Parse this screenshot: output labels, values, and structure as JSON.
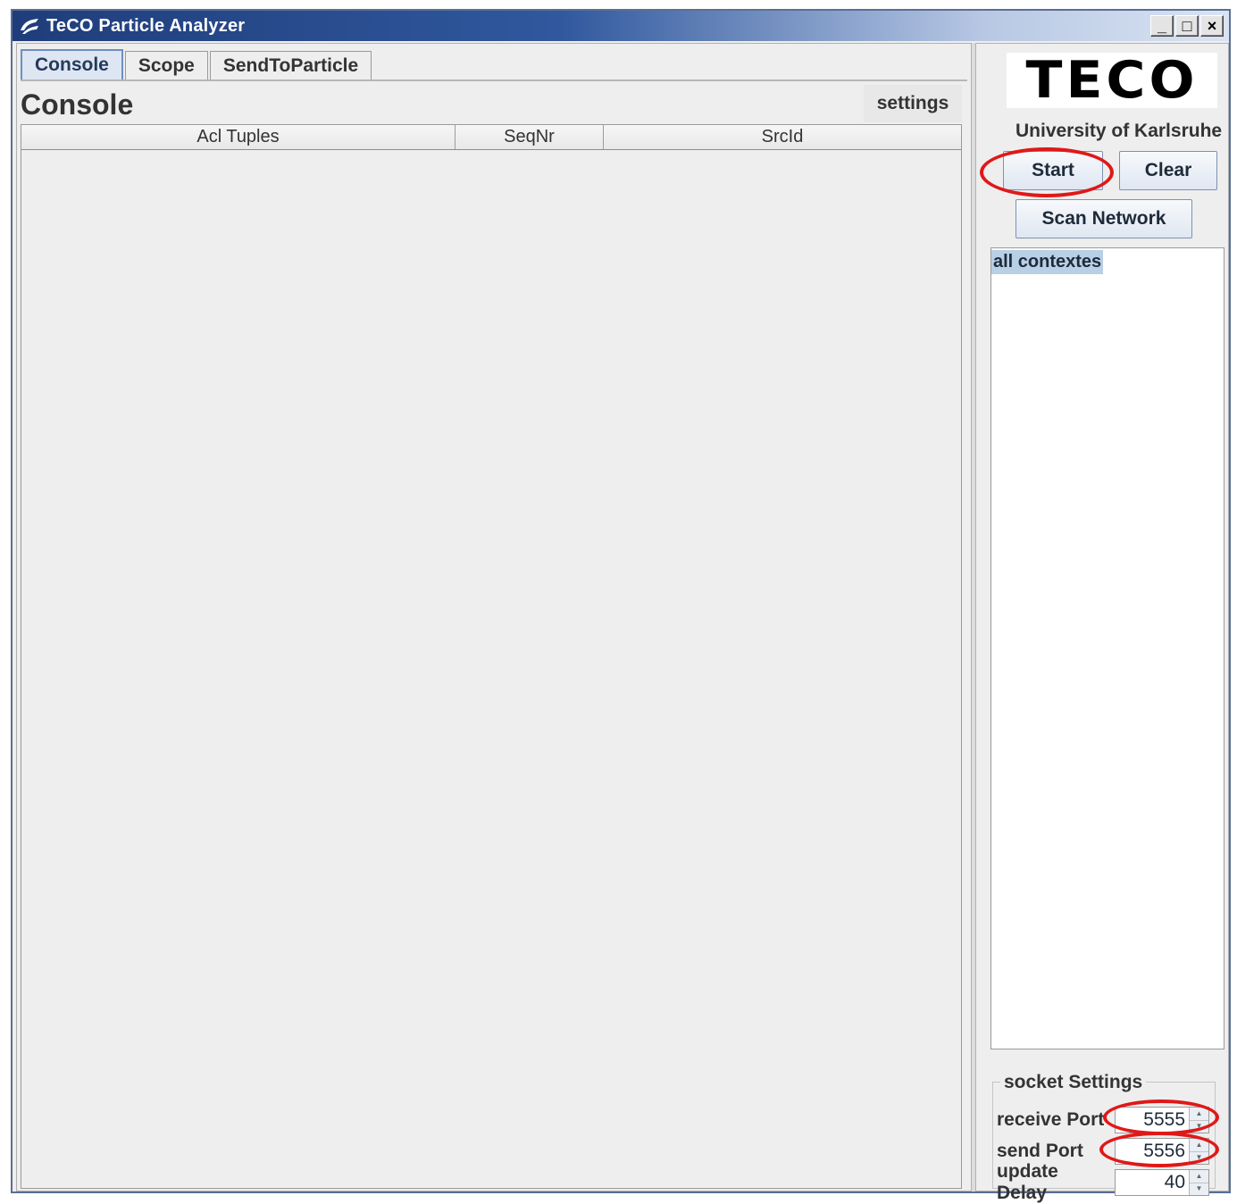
{
  "window": {
    "title": "TeCO Particle Analyzer",
    "controls": {
      "minimize": "_",
      "maximize": "□",
      "close": "×"
    }
  },
  "tabs": [
    {
      "label": "Console",
      "active": true
    },
    {
      "label": "Scope",
      "active": false
    },
    {
      "label": "SendToParticle",
      "active": false
    }
  ],
  "console": {
    "title": "Console",
    "settings_label": "settings",
    "columns": [
      "Acl Tuples",
      "SeqNr",
      "SrcId"
    ],
    "rows": []
  },
  "sidebar": {
    "logo_text": "TECO",
    "university": "University of Karlsruhe",
    "start_label": "Start",
    "clear_label": "Clear",
    "scan_label": "Scan Network",
    "contexts": [
      "all contextes"
    ]
  },
  "socket_settings": {
    "legend": "socket Settings",
    "receive_port_label": "receive Port",
    "receive_port_value": "5555",
    "send_port_label": "send Port",
    "send_port_value": "5556",
    "update_delay_label": "update Delay",
    "update_delay_value": "40"
  },
  "colors": {
    "highlight": "#e01818",
    "title_bar": "#1f3d7a",
    "selected_context": "#b8cfe5"
  },
  "icons": {
    "app_icon": "app-icon",
    "spinner_up": "spinner-up-icon",
    "spinner_down": "spinner-down-icon"
  }
}
